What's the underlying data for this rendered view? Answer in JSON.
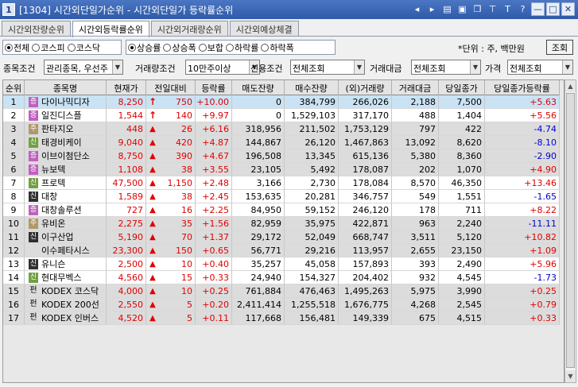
{
  "window": {
    "number": "1",
    "title": "[1304] 시간외단일가순위 - 시간외단일가 등락률순위",
    "help_glyph": "?"
  },
  "tabs": [
    "시간외잔량순위",
    "시간외등락률순위",
    "시간외거래량순위",
    "시간외예상체결"
  ],
  "market_filter": {
    "options": [
      "전체",
      "코스피",
      "코스닥"
    ],
    "selected": 0
  },
  "rank_filter": {
    "options": [
      "상승률",
      "상승폭",
      "보합",
      "하락률",
      "하락폭"
    ],
    "selected": 0
  },
  "unit_label": "*단위 : 주, 백만원",
  "lookup_button": "조회",
  "conditions": [
    {
      "label": "종목조건",
      "value": "관리종목, 우선주"
    },
    {
      "label": "거래량조건",
      "value": "10만주이상"
    },
    {
      "label": "신용조건",
      "value": "전체조회"
    },
    {
      "label": "거래대금",
      "value": "전체조회"
    },
    {
      "label": "가격",
      "value": "전체조회"
    }
  ],
  "columns": [
    "순위",
    "종목명",
    "현재가",
    "전일대비",
    "등락률",
    "매도잔량",
    "매수잔량",
    "(외)거래량",
    "거래대금",
    "당일종가",
    "당일종가등락률"
  ],
  "rows": [
    {
      "rank": "1",
      "badge": "증",
      "badge_type": "jeung",
      "name": "다이나믹디자",
      "price": "8,250",
      "dir": "upper",
      "chg": "750",
      "rate": "+10.00",
      "sell": "0",
      "buy": "384,799",
      "vol": "266,026",
      "amt": "2,188",
      "close": "7,500",
      "close_rate": "+5.63",
      "color": "red"
    },
    {
      "rank": "2",
      "badge": "증",
      "badge_type": "jeung",
      "name": "일진디스플",
      "price": "1,544",
      "dir": "upper",
      "chg": "140",
      "rate": "+9.97",
      "sell": "0",
      "buy": "1,529,103",
      "vol": "317,170",
      "amt": "488",
      "close": "1,404",
      "close_rate": "+5.56",
      "color": "red"
    },
    {
      "rank": "3",
      "badge": "주",
      "badge_type": "ju",
      "name": "판타지오",
      "price": "448",
      "dir": "up",
      "chg": "26",
      "rate": "+6.16",
      "sell": "318,956",
      "buy": "211,502",
      "vol": "1,753,129",
      "amt": "797",
      "close": "422",
      "close_rate": "-4.74",
      "color": "blue"
    },
    {
      "rank": "4",
      "badge": "신",
      "badge_type": "sin",
      "name": "태경비케이",
      "price": "9,040",
      "dir": "up",
      "chg": "420",
      "rate": "+4.87",
      "sell": "144,867",
      "buy": "26,120",
      "vol": "1,467,863",
      "amt": "13,092",
      "close": "8,620",
      "close_rate": "-8.10",
      "color": "blue"
    },
    {
      "rank": "5",
      "badge": "증",
      "badge_type": "jeung",
      "name": "이브이첨단소",
      "price": "8,750",
      "dir": "up",
      "chg": "390",
      "rate": "+4.67",
      "sell": "196,508",
      "buy": "13,345",
      "vol": "615,136",
      "amt": "5,380",
      "close": "8,360",
      "close_rate": "-2.90",
      "color": "blue"
    },
    {
      "rank": "6",
      "badge": "증",
      "badge_type": "jeung",
      "name": "뉴보텍",
      "price": "1,108",
      "dir": "up",
      "chg": "38",
      "rate": "+3.55",
      "sell": "23,105",
      "buy": "5,492",
      "vol": "178,087",
      "amt": "202",
      "close": "1,070",
      "close_rate": "+4.90",
      "color": "red"
    },
    {
      "rank": "7",
      "badge": "신",
      "badge_type": "sin",
      "name": "프로텍",
      "price": "47,500",
      "dir": "up",
      "chg": "1,150",
      "rate": "+2.48",
      "sell": "3,166",
      "buy": "2,730",
      "vol": "178,084",
      "amt": "8,570",
      "close": "46,350",
      "close_rate": "+13.46",
      "color": "red"
    },
    {
      "rank": "8",
      "badge": "신",
      "badge_type": "sin2",
      "name": "대창",
      "price": "1,589",
      "dir": "up",
      "chg": "38",
      "rate": "+2.45",
      "sell": "153,635",
      "buy": "20,281",
      "vol": "346,757",
      "amt": "549",
      "close": "1,551",
      "close_rate": "-1.65",
      "color": "blue"
    },
    {
      "rank": "9",
      "badge": "증",
      "badge_type": "jeung",
      "name": "대창솔루션",
      "price": "727",
      "dir": "up",
      "chg": "16",
      "rate": "+2.25",
      "sell": "84,950",
      "buy": "59,152",
      "vol": "246,120",
      "amt": "178",
      "close": "711",
      "close_rate": "+8.22",
      "color": "red"
    },
    {
      "rank": "10",
      "badge": "주",
      "badge_type": "ju",
      "name": "유비온",
      "price": "2,275",
      "dir": "up",
      "chg": "35",
      "rate": "+1.56",
      "sell": "82,959",
      "buy": "35,975",
      "vol": "422,871",
      "amt": "963",
      "close": "2,240",
      "close_rate": "-11.11",
      "color": "blue"
    },
    {
      "rank": "11",
      "badge": "신",
      "badge_type": "sin2",
      "name": "이구산업",
      "price": "5,190",
      "dir": "up",
      "chg": "70",
      "rate": "+1.37",
      "sell": "29,172",
      "buy": "52,049",
      "vol": "668,747",
      "amt": "3,511",
      "close": "5,120",
      "close_rate": "+10.82",
      "color": "red"
    },
    {
      "rank": "12",
      "badge": "",
      "badge_type": "",
      "name": "이수페타시스",
      "price": "23,300",
      "dir": "up",
      "chg": "150",
      "rate": "+0.65",
      "sell": "56,771",
      "buy": "29,216",
      "vol": "113,957",
      "amt": "2,655",
      "close": "23,150",
      "close_rate": "+1.09",
      "color": "red"
    },
    {
      "rank": "13",
      "badge": "신",
      "badge_type": "sin2",
      "name": "유니슨",
      "price": "2,500",
      "dir": "up",
      "chg": "10",
      "rate": "+0.40",
      "sell": "35,257",
      "buy": "45,058",
      "vol": "157,893",
      "amt": "393",
      "close": "2,490",
      "close_rate": "+5.96",
      "color": "red"
    },
    {
      "rank": "14",
      "badge": "신",
      "badge_type": "sin",
      "name": "현대무벡스",
      "price": "4,560",
      "dir": "up",
      "chg": "15",
      "rate": "+0.33",
      "sell": "24,940",
      "buy": "154,327",
      "vol": "204,402",
      "amt": "932",
      "close": "4,545",
      "close_rate": "-1.73",
      "color": "blue"
    },
    {
      "rank": "15",
      "badge": "펀",
      "badge_type": "pyeon",
      "name": "KODEX 코스닥",
      "price": "4,000",
      "dir": "up",
      "chg": "10",
      "rate": "+0.25",
      "sell": "761,884",
      "buy": "476,463",
      "vol": "1,495,263",
      "amt": "5,975",
      "close": "3,990",
      "close_rate": "+0.25",
      "color": "red"
    },
    {
      "rank": "16",
      "badge": "펀",
      "badge_type": "pyeon",
      "name": "KODEX 200선",
      "price": "2,550",
      "dir": "up",
      "chg": "5",
      "rate": "+0.20",
      "sell": "2,411,414",
      "buy": "1,255,518",
      "vol": "1,676,775",
      "amt": "4,268",
      "close": "2,545",
      "close_rate": "+0.79",
      "color": "red"
    },
    {
      "rank": "17",
      "badge": "펀",
      "badge_type": "pyeon",
      "name": "KODEX 인버스",
      "price": "4,520",
      "dir": "up",
      "chg": "5",
      "rate": "+0.11",
      "sell": "117,668",
      "buy": "156,481",
      "vol": "149,339",
      "amt": "675",
      "close": "4,515",
      "close_rate": "+0.33",
      "color": "red"
    }
  ]
}
